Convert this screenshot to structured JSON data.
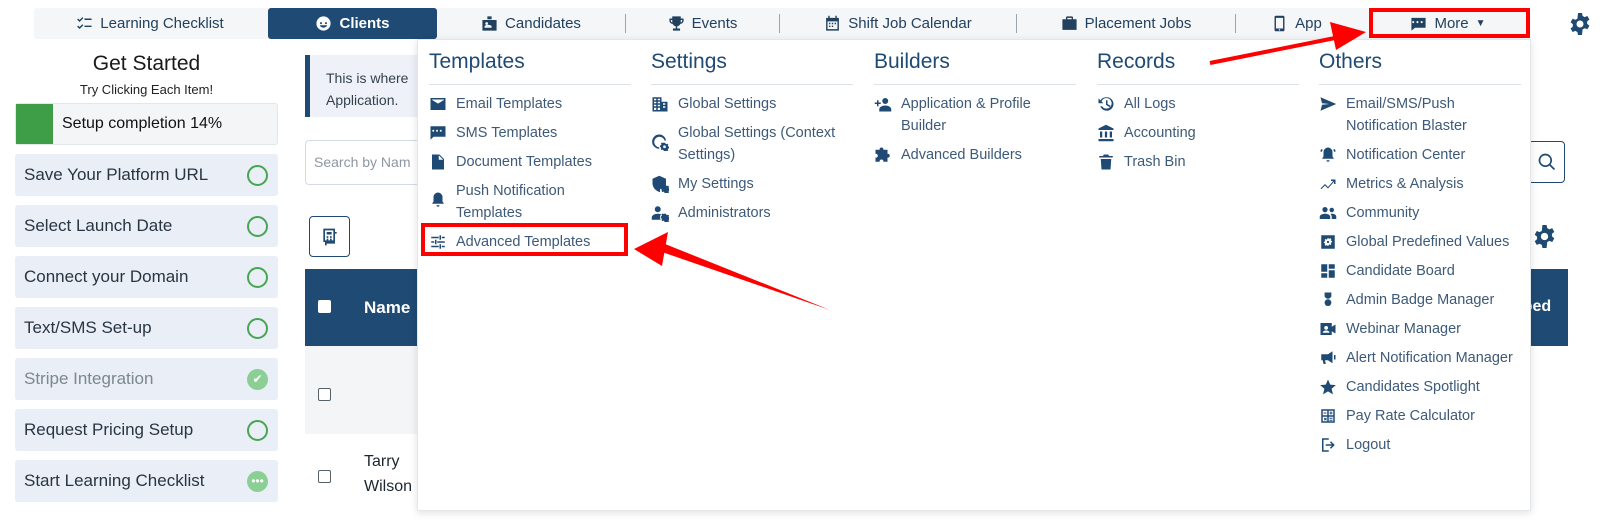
{
  "nav": {
    "items": [
      {
        "label": "Learning Checklist",
        "icon": "checklist-icon"
      },
      {
        "label": "Clients",
        "icon": "face-icon",
        "active": true
      },
      {
        "label": "Candidates",
        "icon": "id-badge-icon"
      },
      {
        "label": "Events",
        "icon": "trophy-icon"
      },
      {
        "label": "Shift Job Calendar",
        "icon": "calendar-icon"
      },
      {
        "label": "Placement Jobs",
        "icon": "briefcase-icon"
      },
      {
        "label": "App",
        "icon": "phone-icon"
      },
      {
        "label": "More",
        "icon": "chat-icon"
      }
    ]
  },
  "sidebar": {
    "title": "Get Started",
    "subtitle": "Try Clicking Each Item!",
    "progress_label": "Setup completion 14%",
    "progress_fraction": 0.14,
    "tasks": [
      {
        "label": "Save Your Platform URL",
        "status": "todo"
      },
      {
        "label": "Select Launch Date",
        "status": "todo"
      },
      {
        "label": "Connect your Domain",
        "status": "todo"
      },
      {
        "label": "Text/SMS Set-up",
        "status": "todo"
      },
      {
        "label": "Stripe Integration",
        "status": "done"
      },
      {
        "label": "Request Pricing Setup",
        "status": "todo"
      },
      {
        "label": "Start Learning Checklist",
        "status": "pending"
      }
    ]
  },
  "main": {
    "info_line1": "This is where",
    "info_line2": "Application.",
    "search_placeholder": "Search by Nam",
    "table_header_name": "Name",
    "table_header_right": "ribed",
    "row_name_line1": "Tarry",
    "row_name_line2": "Wilson"
  },
  "menu": {
    "templates": {
      "title": "Templates",
      "items": [
        "Email Templates",
        "SMS Templates",
        "Document Templates",
        "Push Notification Templates",
        "Advanced Templates"
      ]
    },
    "settings": {
      "title": "Settings",
      "items": [
        "Global Settings",
        "Global Settings (Context Settings)",
        "My Settings",
        "Administrators"
      ]
    },
    "builders": {
      "title": "Builders",
      "items": [
        "Application & Profile Builder",
        "Advanced Builders"
      ]
    },
    "records": {
      "title": "Records",
      "items": [
        "All Logs",
        "Accounting",
        "Trash Bin"
      ]
    },
    "others": {
      "title": "Others",
      "items": [
        "Email/SMS/Push Notification Blaster",
        "Notification Center",
        "Metrics & Analysis",
        "Community",
        "Global Predefined Values",
        "Candidate Board",
        "Admin Badge Manager",
        "Webinar Manager",
        "Alert Notification Manager",
        "Candidates Spotlight",
        "Pay Rate Calculator",
        "Logout"
      ]
    }
  },
  "colors": {
    "primary": "#1f4a73",
    "accent_green": "#3d9e47",
    "highlight_red": "#ff0000"
  }
}
